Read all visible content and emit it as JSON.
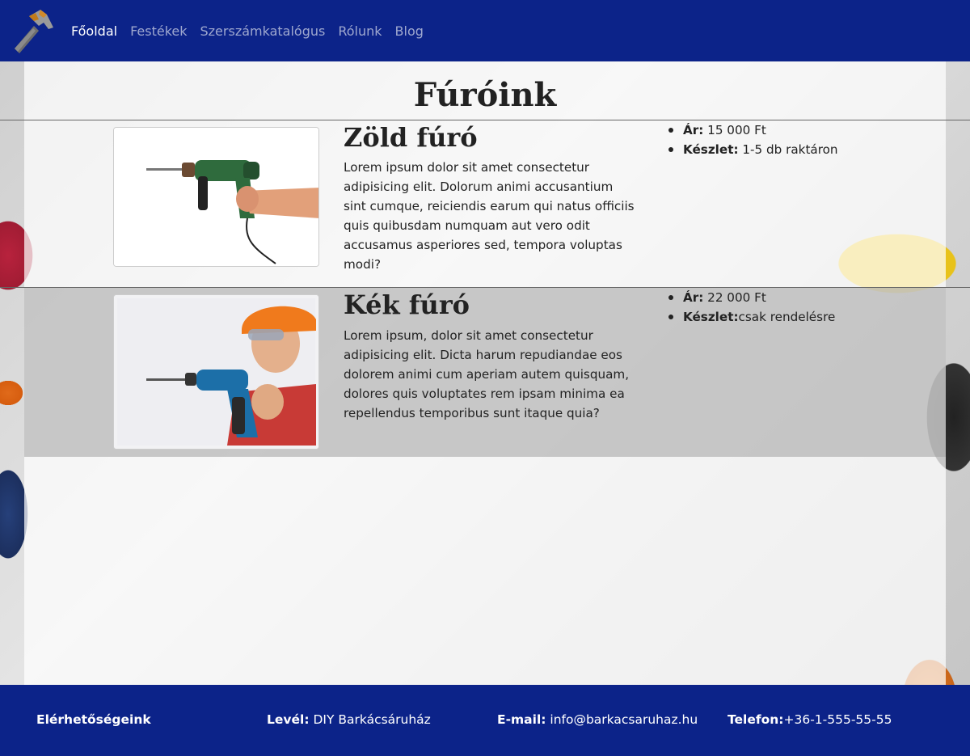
{
  "nav": {
    "logo_icon": "hammer-icon",
    "links": [
      "Főoldal",
      "Festékek",
      "Szerszámkatalógus",
      "Rólunk",
      "Blog"
    ],
    "active": "Főoldal"
  },
  "page": {
    "title": "Fúróink"
  },
  "products": [
    {
      "name": "Zöld fúró",
      "image_icon": "green-drill-image",
      "description": "Lorem ipsum dolor sit amet consectetur adipisicing elit. Dolorum animi accusantium sint cumque, reiciendis earum qui natus officiis quis quibusdam numquam aut vero odit accusamus asperiores sed, tempora voluptas modi?",
      "price_label": "Ár:",
      "price_value": " 15 000 Ft",
      "stock_label": "Készlet:",
      "stock_value": " 1-5 db raktáron"
    },
    {
      "name": "Kék fúró",
      "image_icon": "blue-drill-worker-image",
      "description": "Lorem ipsum, dolor sit amet consectetur adipisicing elit. Dicta harum repudiandae eos dolorem animi cum aperiam autem quisquam, dolores quis voluptates rem ipsam minima ea repellendus temporibus sunt itaque quia?",
      "price_label": "Ár:",
      "price_value": " 22 000 Ft",
      "stock_label": "Készlet:",
      "stock_value": "csak rendelésre"
    }
  ],
  "footer": {
    "heading": "Elérhetőségeink",
    "mail_label": "Levél:",
    "mail_value": " DIY Barkácsáruház",
    "email_label": "E-mail:",
    "email_value": " info@barkacsaruhaz.hu",
    "phone_label": "Telefon:",
    "phone_value": "+36-1-555-55-55"
  },
  "colors": {
    "nav_bg": "#0c2389",
    "footer_bg": "#0c2389",
    "nav_link": "#9fa8cf",
    "nav_link_active": "#ffffff"
  }
}
